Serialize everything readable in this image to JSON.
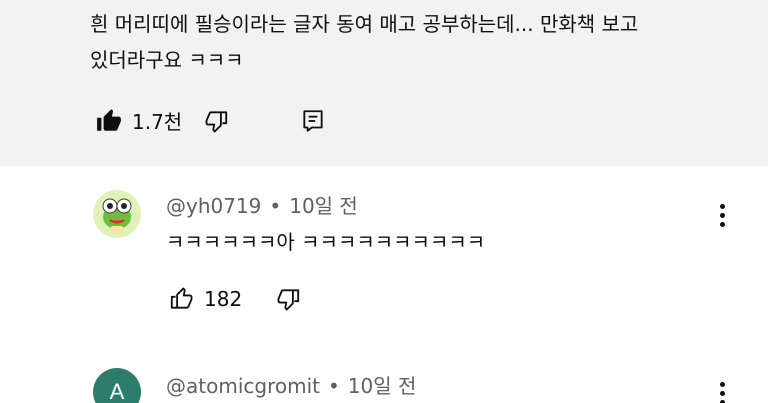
{
  "top_comment": {
    "line1": "흰 머리띠에 필승이라는 글자 동여 매고 공부하는데... 만화책 보고",
    "line2": "있더라구요 ㅋㅋㅋ",
    "like_count": "1.7천",
    "icons": {
      "like": "thumbs-up-filled-icon",
      "dislike": "thumbs-down-icon",
      "reply": "comment-icon"
    }
  },
  "comments": [
    {
      "author": "@yh0719",
      "time": "10일 전",
      "text": "ㅋㅋㅋㅋㅋㅋ아 ㅋㅋㅋㅋㅋㅋㅋㅋㅋㅋ",
      "like_count": "182",
      "avatar": "frog-avatar"
    },
    {
      "author": "@atomicgromit",
      "time": "10일 전",
      "avatar_letter": "A",
      "avatar_color": "#2e7d6b"
    }
  ],
  "separator": "•"
}
